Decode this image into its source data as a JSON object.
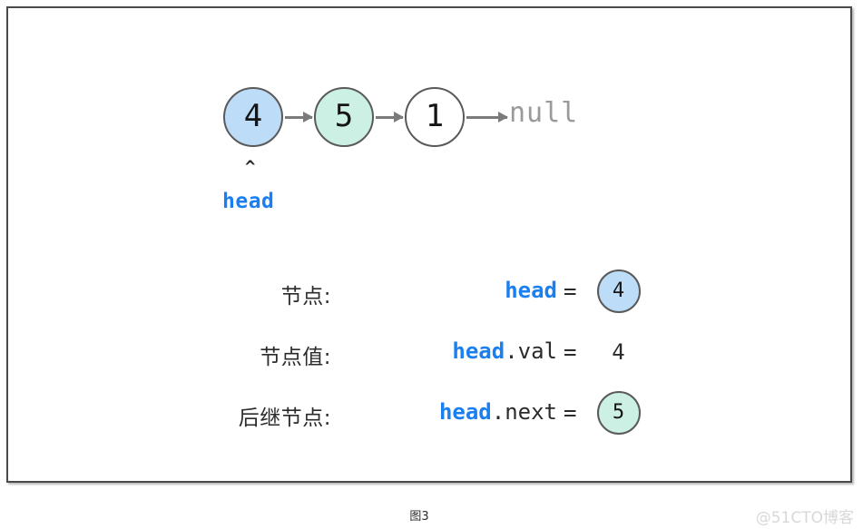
{
  "figure": {
    "caption": "图3",
    "watermark": "@51CTO博客"
  },
  "linked_list": {
    "nodes": [
      {
        "value": "4",
        "color": "#bddcf7"
      },
      {
        "value": "5",
        "color": "#cdf0e4"
      },
      {
        "value": "1",
        "color": "#ffffff"
      }
    ],
    "terminator": "null",
    "pointer": {
      "caret": "^",
      "name": "head",
      "color": "#1a7ff0"
    }
  },
  "legend": {
    "rows": [
      {
        "label": "节点:",
        "ident": "head",
        "field": "",
        "equals": "=",
        "value": "4",
        "value_kind": "circle-blue"
      },
      {
        "label": "节点值:",
        "ident": "head",
        "field": ".val",
        "equals": "=",
        "value": "4",
        "value_kind": "plain"
      },
      {
        "label": "后继节点:",
        "ident": "head",
        "field": ".next",
        "equals": "=",
        "value": "5",
        "value_kind": "circle-green"
      }
    ]
  }
}
